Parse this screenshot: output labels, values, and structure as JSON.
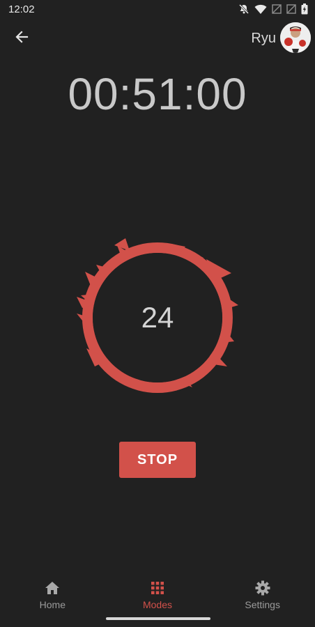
{
  "status_bar": {
    "time": "12:02",
    "icons": [
      "mute-icon",
      "wifi-icon",
      "signal-off-icon",
      "signal-off-icon",
      "battery-icon"
    ]
  },
  "header": {
    "back_icon": "arrow-left-icon",
    "user_name": "Ryu"
  },
  "timer": {
    "value": "00:51:00"
  },
  "breath": {
    "count": "24",
    "accent_color": "#d2514a"
  },
  "actions": {
    "stop_label": "STOP"
  },
  "bottom_nav": {
    "items": [
      {
        "label": "Home",
        "icon": "home-icon",
        "active": false
      },
      {
        "label": "Modes",
        "icon": "grid-icon",
        "active": true
      },
      {
        "label": "Settings",
        "icon": "gear-icon",
        "active": false
      }
    ]
  },
  "colors": {
    "background": "#212121",
    "accent": "#d2514a",
    "text": "#c9c9c9"
  }
}
